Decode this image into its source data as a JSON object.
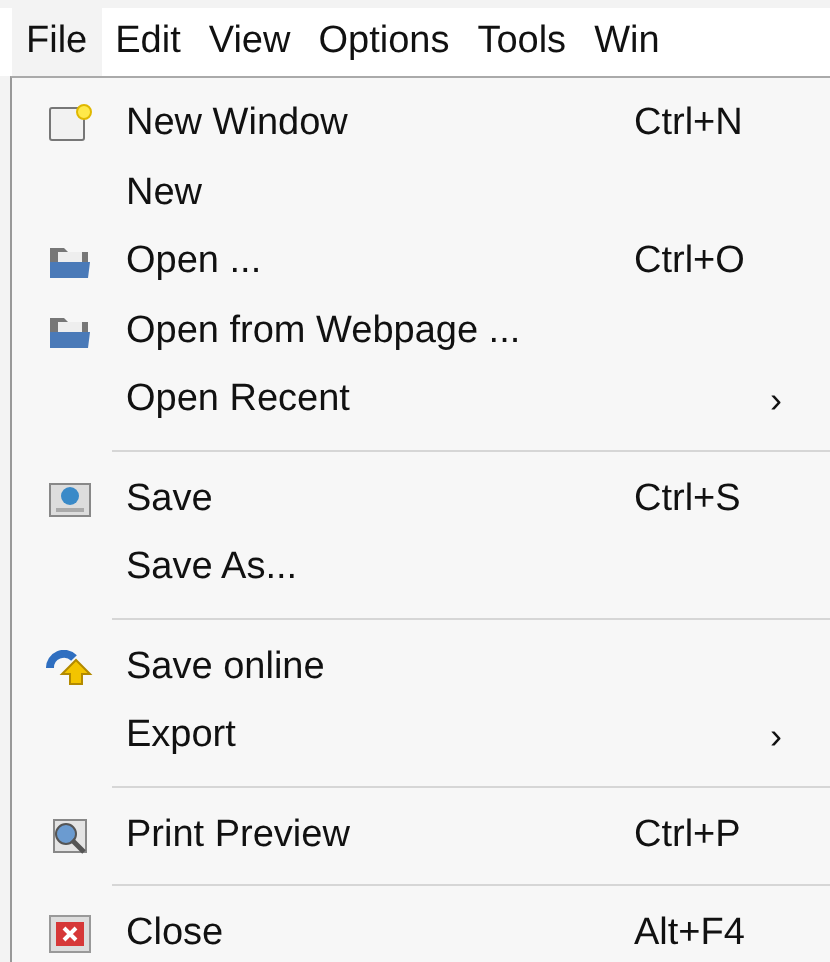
{
  "menu_bar": [
    {
      "label": "File",
      "selected": true
    },
    {
      "label": "Edit",
      "selected": false
    },
    {
      "label": "View",
      "selected": false
    },
    {
      "label": "Options",
      "selected": false
    },
    {
      "label": "Tools",
      "selected": false
    },
    {
      "label": "Win",
      "selected": false
    }
  ],
  "file_menu": [
    {
      "kind": "item",
      "label": "New Window",
      "shortcut": "Ctrl+N"
    },
    {
      "kind": "item",
      "label": "New"
    },
    {
      "kind": "item",
      "label": "Open ...",
      "shortcut": "Ctrl+O"
    },
    {
      "kind": "item",
      "label": "Open from Webpage ..."
    },
    {
      "kind": "submenu",
      "label": "Open Recent",
      "arrow": "›"
    },
    {
      "kind": "separator"
    },
    {
      "kind": "item",
      "label": "Save",
      "shortcut": "Ctrl+S"
    },
    {
      "kind": "item",
      "label": "Save As..."
    },
    {
      "kind": "separator"
    },
    {
      "kind": "item",
      "label": "Save online"
    },
    {
      "kind": "submenu",
      "label": "Export",
      "arrow": "›"
    },
    {
      "kind": "separator"
    },
    {
      "kind": "item",
      "label": "Print Preview",
      "shortcut": "Ctrl+P"
    },
    {
      "kind": "separator"
    },
    {
      "kind": "item",
      "label": "Close",
      "shortcut": "Alt+F4"
    }
  ]
}
